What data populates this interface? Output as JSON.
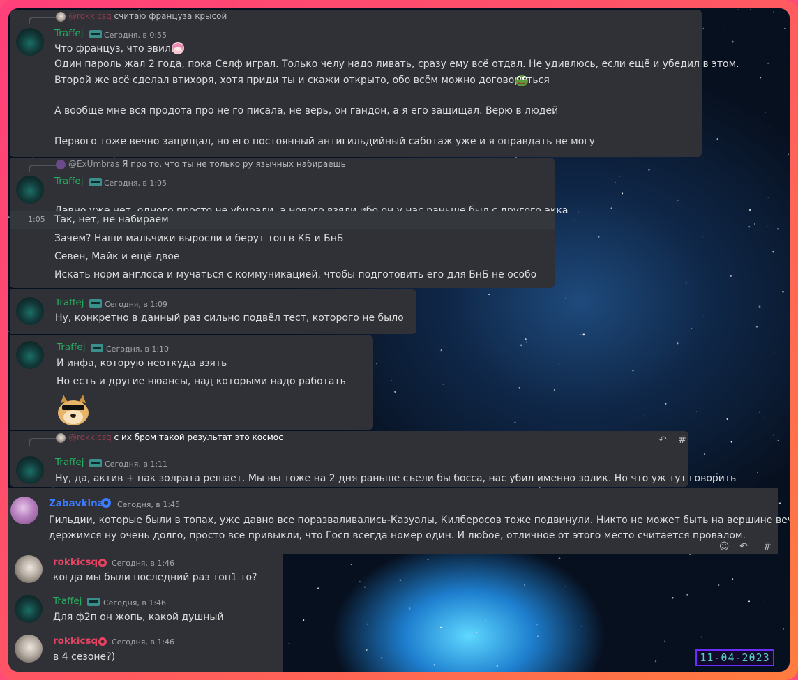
{
  "colors": {
    "traffej": "#27ae60",
    "zabavkina": "#3b7bff",
    "rokkicsq": "#e84362",
    "card": "#2f3136",
    "frame_accent": "#ff4a7a"
  },
  "messages": [
    {
      "reply": {
        "name": "@rokkicsq",
        "text": "считаю француза крысой"
      },
      "author": "Traffej",
      "time": "Сегодня, в 0:55",
      "lines": [
        "Что француз, что эвилз",
        "Один пароль жал 2 года, пока Селф играл. Только челу надо ливать, сразу ему всё отдал. Не удивлюсь, если ещё и убедил в этом.",
        "Второй же всё сделал втихоря, хотя приди ты и скажи открыто, обо всём можно договориться",
        "А вообще мне вся продота про не го писала, не верь, он гандон, а я его защищал. Верю в людей",
        "Первого тоже вечно защищал, но его постоянный антигильдийный саботаж уже и я оправдать не могу"
      ]
    },
    {
      "reply": {
        "name": "@ExUmbras",
        "text": "Я про то, что ты не только ру язычных набираешь"
      },
      "author": "Traffej",
      "time": "Сегодня, в 1:05",
      "lines": [
        "Давно уже нет, одного просто не убирали, а нового взяли ибо он у нас раньше был с другого акка",
        "Так, нет, не набираем",
        "Зачем? Наши мальчики выросли и берут топ в КБ и БнБ",
        "Севен, Майк и ещё двое",
        "Искать норм англоса и мучаться с коммуникацией, чтобы подготовить его для БнБ не особо"
      ],
      "hover_time": "1:05"
    },
    {
      "author": "Traffej",
      "time": "Сегодня, в 1:09",
      "lines": [
        "Ну, конкретно в данный раз сильно подвёл тест, которого не было"
      ]
    },
    {
      "author": "Traffej",
      "time": "Сегодня, в 1:10",
      "lines": [
        "И инфа, которую неоткуда взять",
        "Но есть и другие нюансы, над которыми надо работать"
      ],
      "sticker": "doge-sunglasses"
    },
    {
      "reply": {
        "name": "@rokkicsq",
        "text": "с их бром такой результат это космос"
      },
      "author": "Traffej",
      "time": "Сегодня, в 1:11",
      "lines": [
        "Ну, да, актив + пак золрата решает. Мы вы тоже на 2 дня раньше съели бы босса, нас убил именно золик. Но что уж тут говорить"
      ]
    },
    {
      "author": "Zabavkina",
      "time": "Сегодня, в 1:45",
      "lines": [
        "Гильдии, которые были в топах, уже давно все поразваливались-Казуалы, Килберосов тоже подвинули. Никто не может быть на вершине вечно. Мы",
        "держимся ну очень долго, просто все привыкли, что Госп всегда номер один. И любое, отличное от этого место считается провалом."
      ]
    },
    {
      "author": "rokkicsq",
      "time": "Сегодня, в 1:46",
      "lines": [
        "когда мы были последний раз топ1 то?"
      ]
    },
    {
      "author": "Traffej",
      "time": "Сегодня, в 1:46",
      "lines": [
        "Для ф2п он жопь, какой душный"
      ]
    },
    {
      "author": "rokkicsq",
      "time": "Сегодня, в 1:46",
      "lines": [
        "в 4 сезоне?)"
      ]
    }
  ],
  "date_stamp": "11-04-2023",
  "icons": {
    "reply": "reply-arrow-icon",
    "thread": "thread-icon",
    "reaction": "add-reaction-icon"
  }
}
